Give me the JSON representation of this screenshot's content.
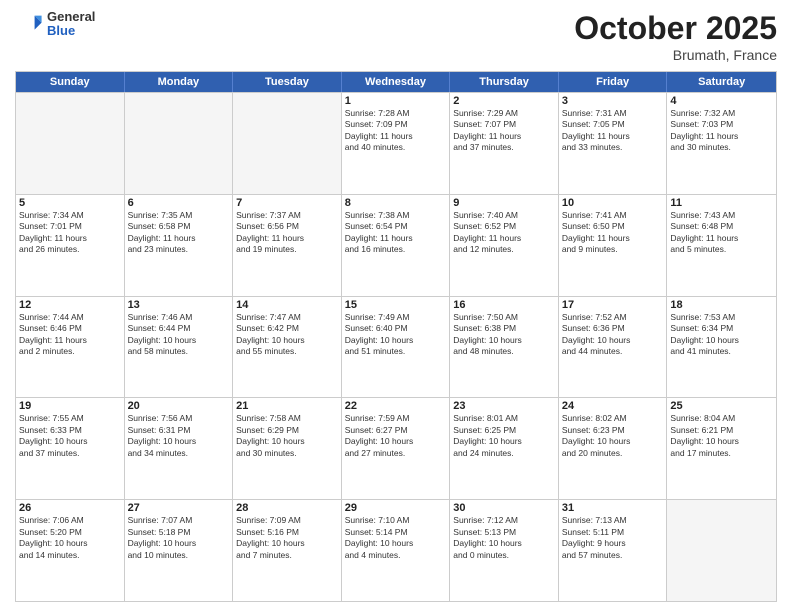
{
  "header": {
    "logo_general": "General",
    "logo_blue": "Blue",
    "month_title": "October 2025",
    "location": "Brumath, France"
  },
  "days_of_week": [
    "Sunday",
    "Monday",
    "Tuesday",
    "Wednesday",
    "Thursday",
    "Friday",
    "Saturday"
  ],
  "weeks": [
    [
      {
        "day": "",
        "lines": [],
        "empty": true
      },
      {
        "day": "",
        "lines": [],
        "empty": true
      },
      {
        "day": "",
        "lines": [],
        "empty": true
      },
      {
        "day": "1",
        "lines": [
          "Sunrise: 7:28 AM",
          "Sunset: 7:09 PM",
          "Daylight: 11 hours",
          "and 40 minutes."
        ]
      },
      {
        "day": "2",
        "lines": [
          "Sunrise: 7:29 AM",
          "Sunset: 7:07 PM",
          "Daylight: 11 hours",
          "and 37 minutes."
        ]
      },
      {
        "day": "3",
        "lines": [
          "Sunrise: 7:31 AM",
          "Sunset: 7:05 PM",
          "Daylight: 11 hours",
          "and 33 minutes."
        ]
      },
      {
        "day": "4",
        "lines": [
          "Sunrise: 7:32 AM",
          "Sunset: 7:03 PM",
          "Daylight: 11 hours",
          "and 30 minutes."
        ]
      }
    ],
    [
      {
        "day": "5",
        "lines": [
          "Sunrise: 7:34 AM",
          "Sunset: 7:01 PM",
          "Daylight: 11 hours",
          "and 26 minutes."
        ]
      },
      {
        "day": "6",
        "lines": [
          "Sunrise: 7:35 AM",
          "Sunset: 6:58 PM",
          "Daylight: 11 hours",
          "and 23 minutes."
        ]
      },
      {
        "day": "7",
        "lines": [
          "Sunrise: 7:37 AM",
          "Sunset: 6:56 PM",
          "Daylight: 11 hours",
          "and 19 minutes."
        ]
      },
      {
        "day": "8",
        "lines": [
          "Sunrise: 7:38 AM",
          "Sunset: 6:54 PM",
          "Daylight: 11 hours",
          "and 16 minutes."
        ]
      },
      {
        "day": "9",
        "lines": [
          "Sunrise: 7:40 AM",
          "Sunset: 6:52 PM",
          "Daylight: 11 hours",
          "and 12 minutes."
        ]
      },
      {
        "day": "10",
        "lines": [
          "Sunrise: 7:41 AM",
          "Sunset: 6:50 PM",
          "Daylight: 11 hours",
          "and 9 minutes."
        ]
      },
      {
        "day": "11",
        "lines": [
          "Sunrise: 7:43 AM",
          "Sunset: 6:48 PM",
          "Daylight: 11 hours",
          "and 5 minutes."
        ]
      }
    ],
    [
      {
        "day": "12",
        "lines": [
          "Sunrise: 7:44 AM",
          "Sunset: 6:46 PM",
          "Daylight: 11 hours",
          "and 2 minutes."
        ]
      },
      {
        "day": "13",
        "lines": [
          "Sunrise: 7:46 AM",
          "Sunset: 6:44 PM",
          "Daylight: 10 hours",
          "and 58 minutes."
        ]
      },
      {
        "day": "14",
        "lines": [
          "Sunrise: 7:47 AM",
          "Sunset: 6:42 PM",
          "Daylight: 10 hours",
          "and 55 minutes."
        ]
      },
      {
        "day": "15",
        "lines": [
          "Sunrise: 7:49 AM",
          "Sunset: 6:40 PM",
          "Daylight: 10 hours",
          "and 51 minutes."
        ]
      },
      {
        "day": "16",
        "lines": [
          "Sunrise: 7:50 AM",
          "Sunset: 6:38 PM",
          "Daylight: 10 hours",
          "and 48 minutes."
        ]
      },
      {
        "day": "17",
        "lines": [
          "Sunrise: 7:52 AM",
          "Sunset: 6:36 PM",
          "Daylight: 10 hours",
          "and 44 minutes."
        ]
      },
      {
        "day": "18",
        "lines": [
          "Sunrise: 7:53 AM",
          "Sunset: 6:34 PM",
          "Daylight: 10 hours",
          "and 41 minutes."
        ]
      }
    ],
    [
      {
        "day": "19",
        "lines": [
          "Sunrise: 7:55 AM",
          "Sunset: 6:33 PM",
          "Daylight: 10 hours",
          "and 37 minutes."
        ]
      },
      {
        "day": "20",
        "lines": [
          "Sunrise: 7:56 AM",
          "Sunset: 6:31 PM",
          "Daylight: 10 hours",
          "and 34 minutes."
        ]
      },
      {
        "day": "21",
        "lines": [
          "Sunrise: 7:58 AM",
          "Sunset: 6:29 PM",
          "Daylight: 10 hours",
          "and 30 minutes."
        ]
      },
      {
        "day": "22",
        "lines": [
          "Sunrise: 7:59 AM",
          "Sunset: 6:27 PM",
          "Daylight: 10 hours",
          "and 27 minutes."
        ]
      },
      {
        "day": "23",
        "lines": [
          "Sunrise: 8:01 AM",
          "Sunset: 6:25 PM",
          "Daylight: 10 hours",
          "and 24 minutes."
        ]
      },
      {
        "day": "24",
        "lines": [
          "Sunrise: 8:02 AM",
          "Sunset: 6:23 PM",
          "Daylight: 10 hours",
          "and 20 minutes."
        ]
      },
      {
        "day": "25",
        "lines": [
          "Sunrise: 8:04 AM",
          "Sunset: 6:21 PM",
          "Daylight: 10 hours",
          "and 17 minutes."
        ]
      }
    ],
    [
      {
        "day": "26",
        "lines": [
          "Sunrise: 7:06 AM",
          "Sunset: 5:20 PM",
          "Daylight: 10 hours",
          "and 14 minutes."
        ]
      },
      {
        "day": "27",
        "lines": [
          "Sunrise: 7:07 AM",
          "Sunset: 5:18 PM",
          "Daylight: 10 hours",
          "and 10 minutes."
        ]
      },
      {
        "day": "28",
        "lines": [
          "Sunrise: 7:09 AM",
          "Sunset: 5:16 PM",
          "Daylight: 10 hours",
          "and 7 minutes."
        ]
      },
      {
        "day": "29",
        "lines": [
          "Sunrise: 7:10 AM",
          "Sunset: 5:14 PM",
          "Daylight: 10 hours",
          "and 4 minutes."
        ]
      },
      {
        "day": "30",
        "lines": [
          "Sunrise: 7:12 AM",
          "Sunset: 5:13 PM",
          "Daylight: 10 hours",
          "and 0 minutes."
        ]
      },
      {
        "day": "31",
        "lines": [
          "Sunrise: 7:13 AM",
          "Sunset: 5:11 PM",
          "Daylight: 9 hours",
          "and 57 minutes."
        ]
      },
      {
        "day": "",
        "lines": [],
        "empty": true
      }
    ]
  ]
}
